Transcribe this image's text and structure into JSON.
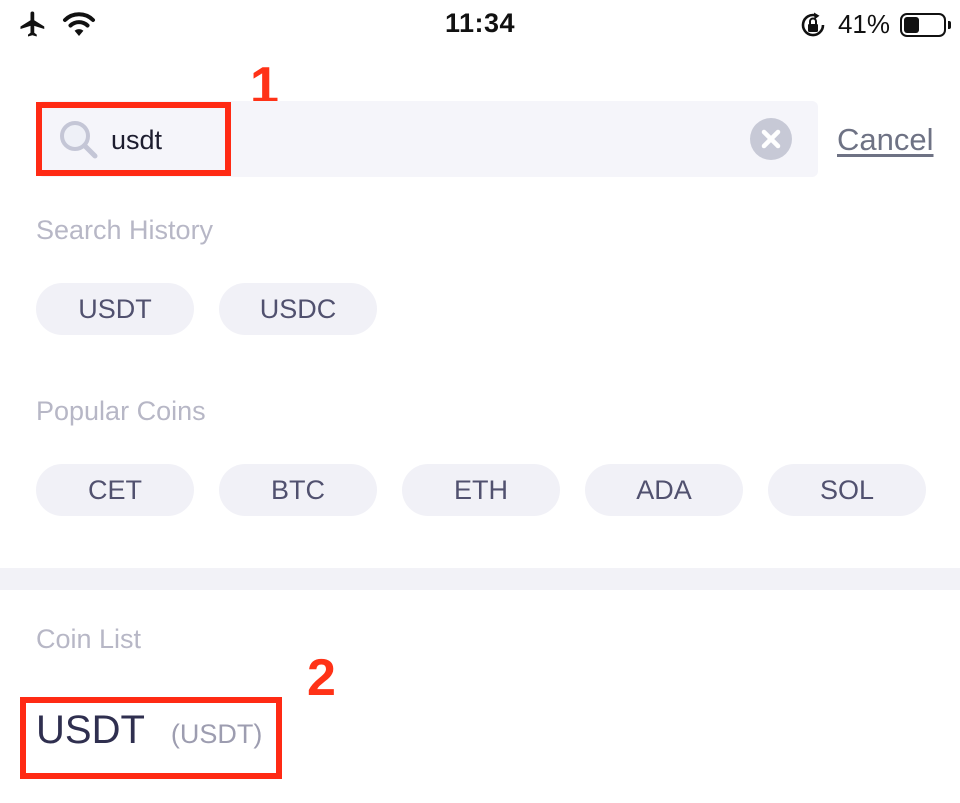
{
  "status_bar": {
    "time": "11:34",
    "battery_percent": "41%",
    "battery_level": 0.41,
    "icons": [
      "airplane-icon",
      "wifi-icon",
      "orientation-lock-icon",
      "battery-icon"
    ]
  },
  "search": {
    "value": "usdt",
    "placeholder": "",
    "cancel_label": "Cancel"
  },
  "search_history": {
    "title": "Search History",
    "items": [
      "USDT",
      "USDC"
    ]
  },
  "popular_coins": {
    "title": "Popular Coins",
    "items": [
      "CET",
      "BTC",
      "ETH",
      "ADA",
      "SOL"
    ]
  },
  "coin_list": {
    "title": "Coin List",
    "items": [
      {
        "name": "USDT",
        "ticker": "(USDT)"
      }
    ]
  },
  "annotations": {
    "step1": "1",
    "step2": "2",
    "highlight_color": "#ff2a14"
  }
}
